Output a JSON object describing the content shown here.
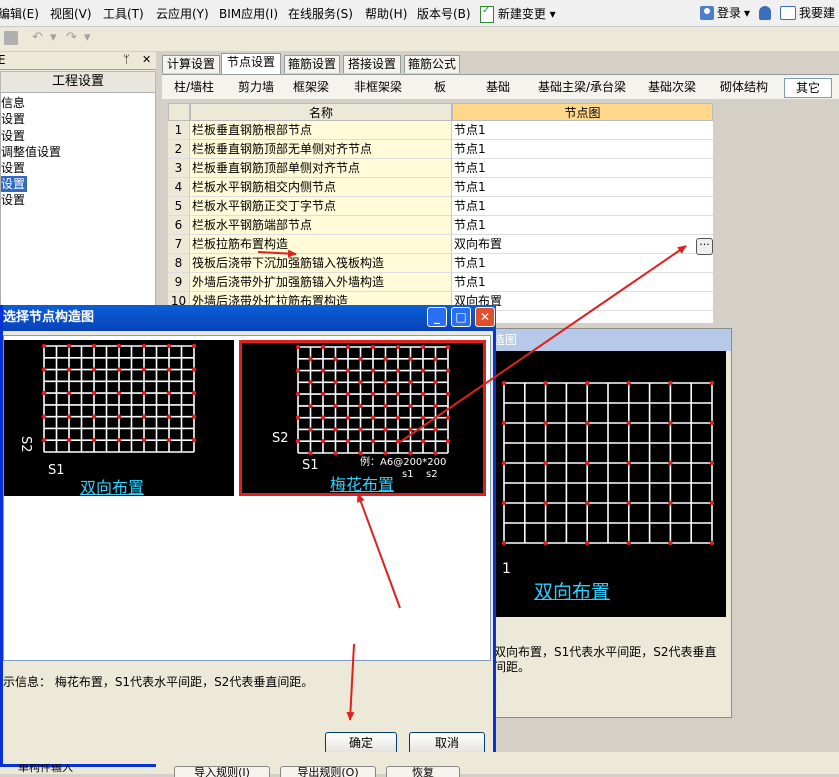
{
  "menu": {
    "items": [
      "编辑(E)",
      "视图(V)",
      "工具(T)",
      "云应用(Y)",
      "BIM应用(I)",
      "在线服务(S)",
      "帮助(H)",
      "版本号(B)",
      "新建变更"
    ],
    "dropdown_arrow": "▾",
    "login_label": "登录",
    "feedback_label": "我要建"
  },
  "left_panel": {
    "pin": "ᛘ",
    "close": "✕",
    "head_label": "E",
    "title": "工程设置",
    "items": [
      "信息",
      "设置",
      "设置",
      "调整值设置",
      "设置",
      "设置",
      "设置"
    ],
    "selected_index": 5
  },
  "tabs": [
    "计算设置",
    "节点设置",
    "箍筋设置",
    "搭接设置",
    "箍筋公式"
  ],
  "active_tab": 1,
  "subtabs": [
    "柱/墙柱",
    "剪力墙",
    "框架梁",
    "非框架梁",
    "板",
    "基础",
    "基础主梁/承台梁",
    "基础次梁",
    "砌体结构",
    "其它"
  ],
  "active_subtab": 9,
  "grid": {
    "col_name": "名称",
    "col_node": "节点图",
    "rows": [
      {
        "num": "1",
        "name": "栏板垂直钢筋根部节点",
        "value": "节点1"
      },
      {
        "num": "2",
        "name": "栏板垂直钢筋顶部无单侧对齐节点",
        "value": "节点1"
      },
      {
        "num": "3",
        "name": "栏板垂直钢筋顶部单侧对齐节点",
        "value": "节点1"
      },
      {
        "num": "4",
        "name": "栏板水平钢筋相交内侧节点",
        "value": "节点1"
      },
      {
        "num": "5",
        "name": "栏板水平钢筋正交丁字节点",
        "value": "节点1"
      },
      {
        "num": "6",
        "name": "栏板水平钢筋端部节点",
        "value": "节点1"
      },
      {
        "num": "7",
        "name": "栏板拉筋布置构造",
        "value": "双向布置"
      },
      {
        "num": "8",
        "name": "筏板后浇带下沉加强筋锚入筏板构造",
        "value": "节点1"
      },
      {
        "num": "9",
        "name": "外墙后浇带外扩加强筋锚入外墙构造",
        "value": "节点1"
      },
      {
        "num": "10",
        "name": "外墙后浇带外扩拉筋布置构造",
        "value": "双向布置"
      }
    ],
    "ellipsis": "···"
  },
  "bg_dialog": {
    "title": "造图",
    "label": "双向布置",
    "dim_s1": "1",
    "info": "双向布置，S1代表水平间距，S2代表垂直间距。"
  },
  "dialog": {
    "title": "选择节点构造图",
    "btn_min": "_",
    "btn_max": "□",
    "btn_close": "✕",
    "options": [
      {
        "label": "双向布置",
        "s1": "S1",
        "s2": "S2"
      },
      {
        "label": "梅花布置",
        "s1": "S1",
        "s2": "S2",
        "example": "例：A6@200*200",
        "ex_s1": "s1",
        "ex_s2": "s2"
      }
    ],
    "selected_option": 1,
    "info": "示信息： 梅花布置，S1代表水平间距，S2代表垂直间距。",
    "ok_label": "确定",
    "cancel_label": "取消"
  },
  "bottom": {
    "left_text": "单构件输入",
    "buttons": [
      "导入规则(I)",
      "导出规则(O)",
      "恢复"
    ]
  },
  "colors": {
    "title_blue": "#0a5fd8",
    "arrow_red": "#e0201c",
    "cad_dot_red": "#e02020",
    "cad_label_cyan": "#2ad0ff",
    "node_header": "#ffd88c"
  }
}
